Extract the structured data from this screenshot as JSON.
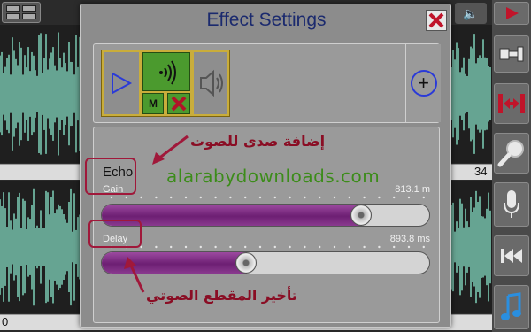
{
  "editor": {
    "timeline_left_top": "",
    "timeline_right_top": "34",
    "timeline_left_bottom": "0",
    "wave_color": "#7fd0b8"
  },
  "dialog": {
    "title": "Effect Settings",
    "add_label": "+",
    "mute_label": "M",
    "effect_name": "Echo",
    "params": [
      {
        "label": "Gain",
        "value": "813.1 m",
        "level_fraction": 0.79
      },
      {
        "label": "Delay",
        "value": "893.8 ms",
        "level_fraction": 0.44
      }
    ]
  },
  "annotations": {
    "echo_note": "إضافة صدى للصوت",
    "delay_note": "تأخير المقطع الصوتي",
    "color": "#a0183a"
  },
  "watermark": "alarabydownloads.com",
  "icons": [
    "menu-icon",
    "volume-icon",
    "play-icon",
    "import-icon",
    "trim-icon",
    "search-icon",
    "mic-icon",
    "rewind-icon",
    "music-note-icon",
    "close-icon",
    "speaker-icon",
    "add-icon"
  ]
}
